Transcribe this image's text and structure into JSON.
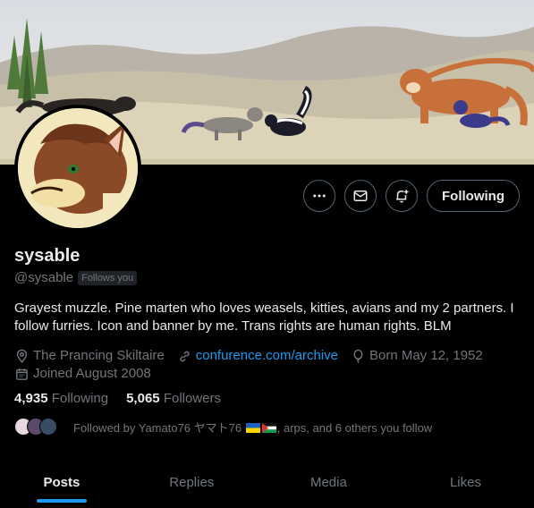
{
  "profile": {
    "display_name": "sysable",
    "handle": "@sysable",
    "follows_you_badge": "Follows you",
    "bio": "Grayest muzzle. Pine marten who loves weasels, kitties, avians and my 2 partners. I follow furries. Icon and banner by me. Trans rights are human rights. BLM",
    "location": "The Prancing Skiltaire",
    "website": "confurence.com/archive",
    "birthday": "Born May 12, 1952",
    "joined": "Joined August 2008"
  },
  "counts": {
    "following_num": "4,935",
    "following_label": "Following",
    "followers_num": "5,065",
    "followers_label": "Followers"
  },
  "followed_by": {
    "prefix": "Followed by Yamato76 ヤマト76",
    "suffix": ", arps, and 6 others you follow"
  },
  "actions": {
    "more_icon": "more-icon",
    "message_icon": "envelope-icon",
    "notify_icon": "bell-plus-icon",
    "following_label": "Following"
  },
  "tabs": [
    {
      "label": "Posts",
      "active": true
    },
    {
      "label": "Replies",
      "active": false
    },
    {
      "label": "Media",
      "active": false
    },
    {
      "label": "Likes",
      "active": false
    }
  ],
  "colors": {
    "accent": "#1d9bf0",
    "background": "#000000",
    "text": "#e7e9ea",
    "muted": "#71767b"
  }
}
